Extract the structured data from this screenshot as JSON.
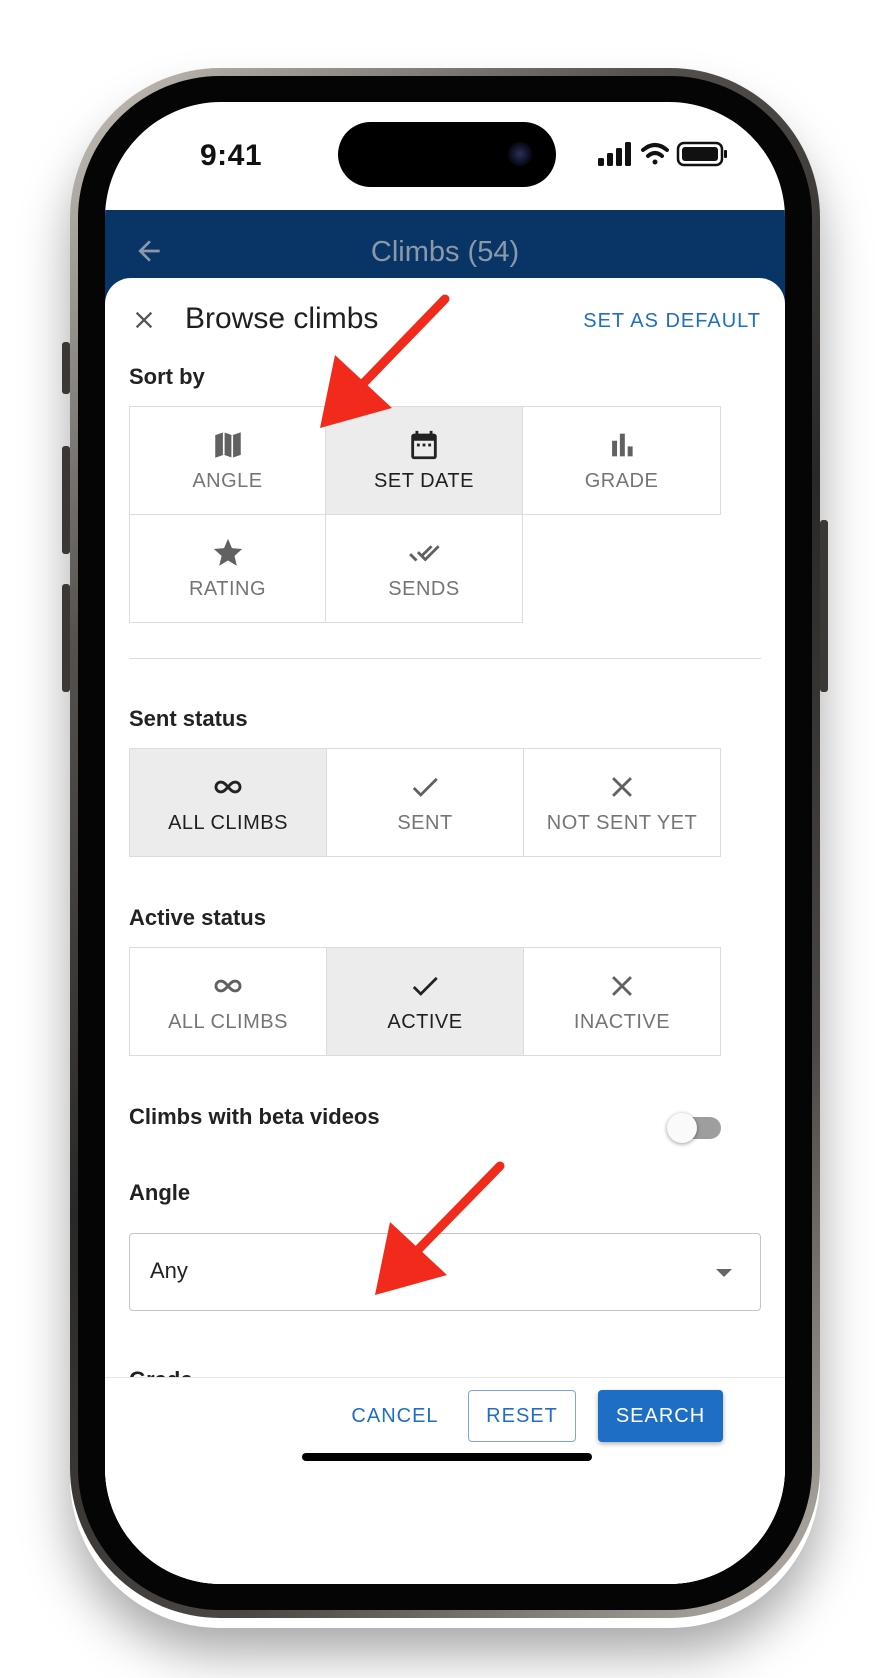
{
  "status_bar": {
    "time": "9:41"
  },
  "app_bar": {
    "title": "Climbs (54)"
  },
  "sheet": {
    "title": "Browse climbs",
    "set_default_label": "SET AS DEFAULT"
  },
  "sort_by": {
    "label": "Sort by",
    "options": [
      {
        "label": "ANGLE",
        "icon": "map-icon",
        "selected": false
      },
      {
        "label": "SET DATE",
        "icon": "calendar-icon",
        "selected": true
      },
      {
        "label": "GRADE",
        "icon": "bar-chart-icon",
        "selected": false
      },
      {
        "label": "RATING",
        "icon": "star-icon",
        "selected": false
      },
      {
        "label": "SENDS",
        "icon": "double-check-icon",
        "selected": false
      }
    ]
  },
  "sent_status": {
    "label": "Sent status",
    "options": [
      {
        "label": "ALL CLIMBS",
        "icon": "infinity-icon",
        "selected": true
      },
      {
        "label": "SENT",
        "icon": "check-icon",
        "selected": false
      },
      {
        "label": "NOT SENT YET",
        "icon": "close-icon",
        "selected": false
      }
    ]
  },
  "active_status": {
    "label": "Active status",
    "options": [
      {
        "label": "ALL CLIMBS",
        "icon": "infinity-icon",
        "selected": false
      },
      {
        "label": "ACTIVE",
        "icon": "check-icon",
        "selected": true
      },
      {
        "label": "INACTIVE",
        "icon": "close-icon",
        "selected": false
      }
    ]
  },
  "beta_videos": {
    "label": "Climbs with beta videos",
    "enabled": false
  },
  "angle": {
    "label": "Angle",
    "value": "Any"
  },
  "grade": {
    "label": "Grade"
  },
  "footer": {
    "cancel_label": "CANCEL",
    "reset_label": "RESET",
    "search_label": "SEARCH"
  },
  "colors": {
    "app_bar": "#083566",
    "accent": "#1f6ec5",
    "annotation_arrow": "#f22a1b",
    "selected_bg": "#ececec"
  }
}
